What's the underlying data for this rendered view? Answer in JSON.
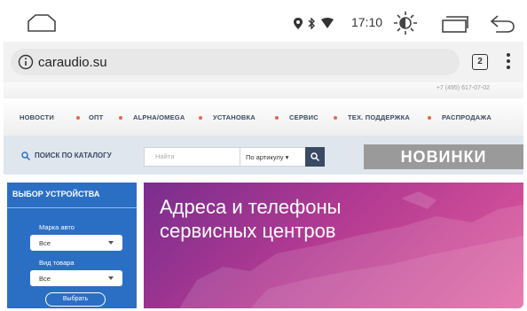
{
  "status_bar": {
    "time": "17:10",
    "icons": [
      "home-outline-icon",
      "location-icon",
      "bluetooth-icon",
      "wifi-icon",
      "brightness-icon",
      "recents-icon",
      "back-icon"
    ]
  },
  "browser": {
    "url": "caraudio.su",
    "tabs_count": "2"
  },
  "site": {
    "phone": "+7 (495) 617-07-02",
    "nav": [
      "НОВОСТИ",
      "ОПТ",
      "ALPHA/OMEGA",
      "УСТАНОВКА",
      "СЕРВИС",
      "ТЕХ. ПОДДЕРЖКА",
      "РАСПРОДАЖА"
    ],
    "search": {
      "catalog_label": "ПОИСК ПО КАТАЛОГУ",
      "placeholder": "Найти",
      "mode": "По артикулу ▾"
    },
    "novinki": "НОВИНКИ",
    "sidebar": {
      "title": "ВЫБОР УСТРОЙСТВА",
      "brand_label": "Марка авто",
      "brand_value": "Все",
      "type_label": "Вид товара",
      "type_value": "Все",
      "button": "Выбрать"
    },
    "banner": {
      "line1": "Адреса и телефоны",
      "line2": "сервисных центров"
    }
  },
  "colors": {
    "nav_text": "#3a4a63",
    "sidebar_bg": "#2b6fc5",
    "banner_start": "#7a2d8f",
    "banner_end": "#e05a9c",
    "novinki_bg": "#9a9a9a"
  }
}
